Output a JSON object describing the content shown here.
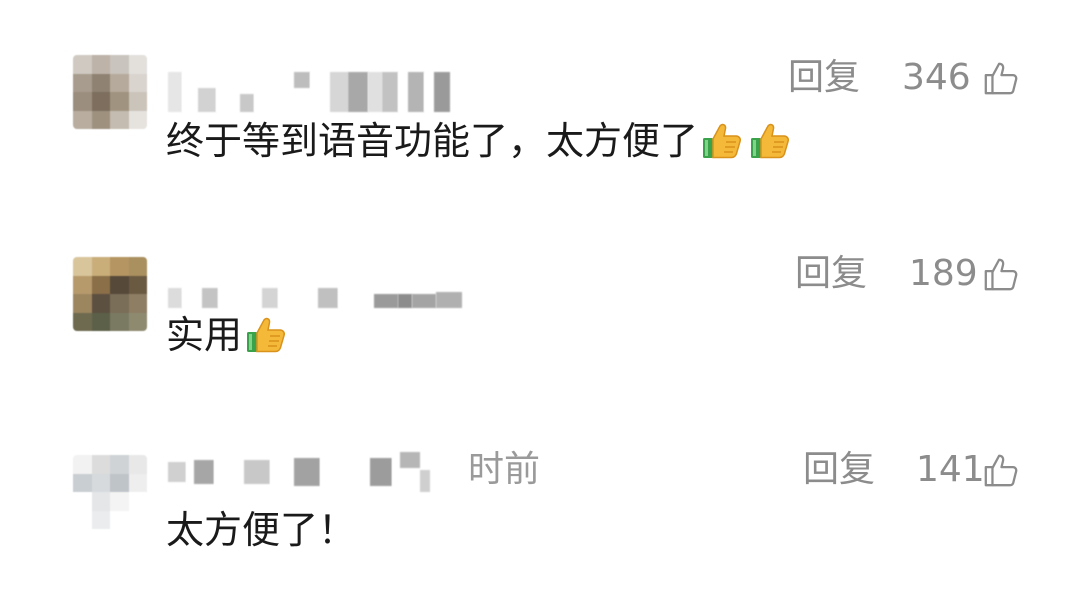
{
  "comments": [
    {
      "reply_label": "回复",
      "like_count": "346",
      "time_suffix": "",
      "text": "终于等到语音功能了，太方便了",
      "emoji_count": 2,
      "emoji_icon": "thumbs-up-emoji"
    },
    {
      "reply_label": "回复",
      "like_count": "189",
      "time_suffix": "",
      "text": "实用",
      "emoji_count": 1,
      "emoji_icon": "thumbs-up-emoji"
    },
    {
      "reply_label": "回复",
      "like_count": "141",
      "time_suffix": "时前",
      "text": "太方便了！",
      "emoji_count": 0,
      "emoji_icon": "thumbs-up-emoji"
    }
  ],
  "icons": {
    "like": "thumbs-up-outline-icon"
  },
  "colors": {
    "meta_text": "#8c8c8c",
    "body_text": "#1a1a1a",
    "background": "#ffffff"
  }
}
